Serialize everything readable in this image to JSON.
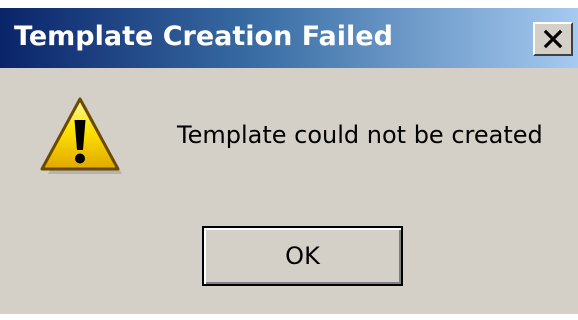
{
  "dialog": {
    "title": "Template Creation Failed",
    "message": "Template could not be created",
    "ok_label": "OK",
    "close_glyph": "X",
    "icon": "warning-icon"
  },
  "colors": {
    "title_start": "#0a246a",
    "title_end": "#a6caf0",
    "face": "#d4d0c8",
    "warning_yellow": "#ffd700"
  }
}
